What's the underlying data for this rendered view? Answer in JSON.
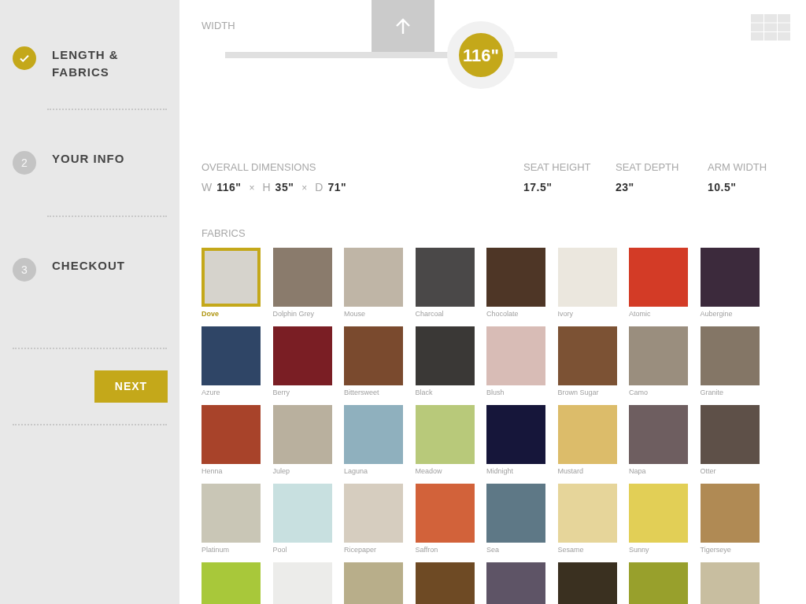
{
  "steps": [
    {
      "label": "LENGTH &\nFABRICS",
      "done": true
    },
    {
      "number": "2",
      "label": "YOUR INFO",
      "done": false
    },
    {
      "number": "3",
      "label": "CHECKOUT",
      "done": false
    }
  ],
  "next_button": "NEXT",
  "width_slider": {
    "label": "WIDTH",
    "reading": "116\"",
    "level": 0.77
  },
  "overall_dimensions": {
    "label": "OVERALL DIMENSIONS",
    "items": [
      {
        "axis": "W",
        "value": "116\""
      },
      {
        "axis": "H",
        "value": "35\""
      },
      {
        "axis": "D",
        "value": "71\""
      }
    ],
    "separator": "×"
  },
  "measurements": [
    {
      "label": "SEAT HEIGHT",
      "value": "17.5\""
    },
    {
      "label": "SEAT DEPTH",
      "value": "23\""
    },
    {
      "label": "ARM WIDTH",
      "value": "10.5\""
    }
  ],
  "fabrics_label": "FABRICS",
  "fabrics": [
    {
      "name": "Dove",
      "color": "#d6d3cc",
      "selected": true
    },
    {
      "name": "Dolphin Grey",
      "color": "#8a7b6c",
      "selected": false
    },
    {
      "name": "Mouse",
      "color": "#bfb5a6",
      "selected": false
    },
    {
      "name": "Charcoal",
      "color": "#4a4848",
      "selected": false
    },
    {
      "name": "Chocolate",
      "color": "#4e3626",
      "selected": false
    },
    {
      "name": "Ivory",
      "color": "#ebe7de",
      "selected": false
    },
    {
      "name": "Atomic",
      "color": "#d33b26",
      "selected": false
    },
    {
      "name": "Aubergine",
      "color": "#3c2a3c",
      "selected": false
    },
    {
      "name": "Azure",
      "color": "#2f4566",
      "selected": false
    },
    {
      "name": "Berry",
      "color": "#7a1e24",
      "selected": false
    },
    {
      "name": "Bittersweet",
      "color": "#7a4a2e",
      "selected": false
    },
    {
      "name": "Black",
      "color": "#3a3836",
      "selected": false
    },
    {
      "name": "Blush",
      "color": "#d8bcb6",
      "selected": false
    },
    {
      "name": "Brown Sugar",
      "color": "#7c5234",
      "selected": false
    },
    {
      "name": "Camo",
      "color": "#9a8e7e",
      "selected": false
    },
    {
      "name": "Granite",
      "color": "#847666",
      "selected": false
    },
    {
      "name": "Henna",
      "color": "#a8432a",
      "selected": false
    },
    {
      "name": "Julep",
      "color": "#b9b09e",
      "selected": false
    },
    {
      "name": "Laguna",
      "color": "#8fb0be",
      "selected": false
    },
    {
      "name": "Meadow",
      "color": "#b8c97a",
      "selected": false
    },
    {
      "name": "Midnight",
      "color": "#16163a",
      "selected": false
    },
    {
      "name": "Mustard",
      "color": "#dcbc6a",
      "selected": false
    },
    {
      "name": "Napa",
      "color": "#6e5e60",
      "selected": false
    },
    {
      "name": "Otter",
      "color": "#5e5048",
      "selected": false
    },
    {
      "name": "Platinum",
      "color": "#c9c6b6",
      "selected": false
    },
    {
      "name": "Pool",
      "color": "#c8e0e0",
      "selected": false
    },
    {
      "name": "Ricepaper",
      "color": "#d6cdbf",
      "selected": false
    },
    {
      "name": "Saffron",
      "color": "#d2623a",
      "selected": false
    },
    {
      "name": "Sea",
      "color": "#5e7886",
      "selected": false
    },
    {
      "name": "Sesame",
      "color": "#e6d59a",
      "selected": false
    },
    {
      "name": "Sunny",
      "color": "#e2cf56",
      "selected": false
    },
    {
      "name": "Tigerseye",
      "color": "#b08a54",
      "selected": false
    },
    {
      "color": "#a8c83a",
      "selected": false
    },
    {
      "color": "#ececea",
      "selected": false
    },
    {
      "color": "#b8ae8a",
      "selected": false
    },
    {
      "color": "#6e4a24",
      "selected": false
    },
    {
      "color": "#5e5466",
      "selected": false
    },
    {
      "color": "#3a3020",
      "selected": false
    },
    {
      "color": "#98a02c",
      "selected": false
    },
    {
      "color": "#c8bea0",
      "selected": false
    }
  ]
}
